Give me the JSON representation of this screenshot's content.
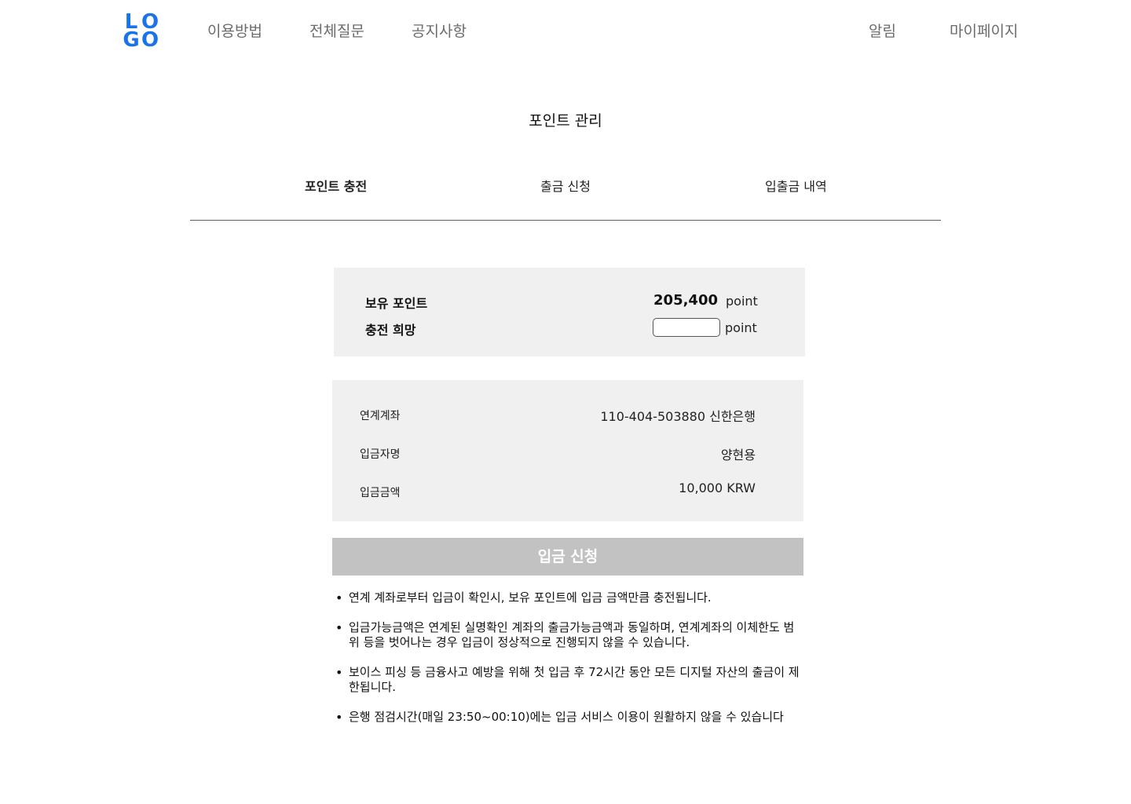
{
  "header": {
    "logo_letters": [
      "L",
      "O",
      "G",
      "O"
    ],
    "nav_left": [
      "이용방법",
      "전체질문",
      "공지사항"
    ],
    "nav_right": [
      "알림",
      "마이페이지"
    ],
    "brand_color": "#1a73e8"
  },
  "page_title": "포인트 관리",
  "tabs": [
    {
      "label": "포인트 충전",
      "active": true
    },
    {
      "label": "출금 신청",
      "active": false
    },
    {
      "label": "입출금 내역",
      "active": false
    }
  ],
  "points": {
    "held_label": "보유 포인트",
    "held_value": "205,400",
    "held_unit": "point",
    "charge_label": "충전 희망",
    "charge_value": "",
    "charge_unit": "point"
  },
  "account": {
    "linked_label": "연계계좌",
    "linked_value": "110-404-503880 신한은행",
    "depositor_label": "입금자명",
    "depositor_value": "양현용",
    "amount_label": "입금금액",
    "amount_value": "10,000 KRW"
  },
  "submit_label": "입금 신청",
  "notes": [
    "연계 계좌로부터 입금이 확인시, 보유 포인트에 입금 금액만큼 충전됩니다.",
    "입금가능금액은 연계된 실명확인 계좌의 출금가능금액과 동일하며, 연계계좌의 이체한도 범위 등을 벗어나는 경우 입금이 정상적으로 진행되지 않을 수 있습니다.",
    "보이스 피싱 등 금융사고 예방을 위해 첫 입금 후 72시간 동안 모든 디지털 자산의 출금이 제한됩니다.",
    "은행 점검시간(매일 23:50~00:10)에는 입금 서비스 이용이 원활하지 않을 수 있습니다"
  ]
}
